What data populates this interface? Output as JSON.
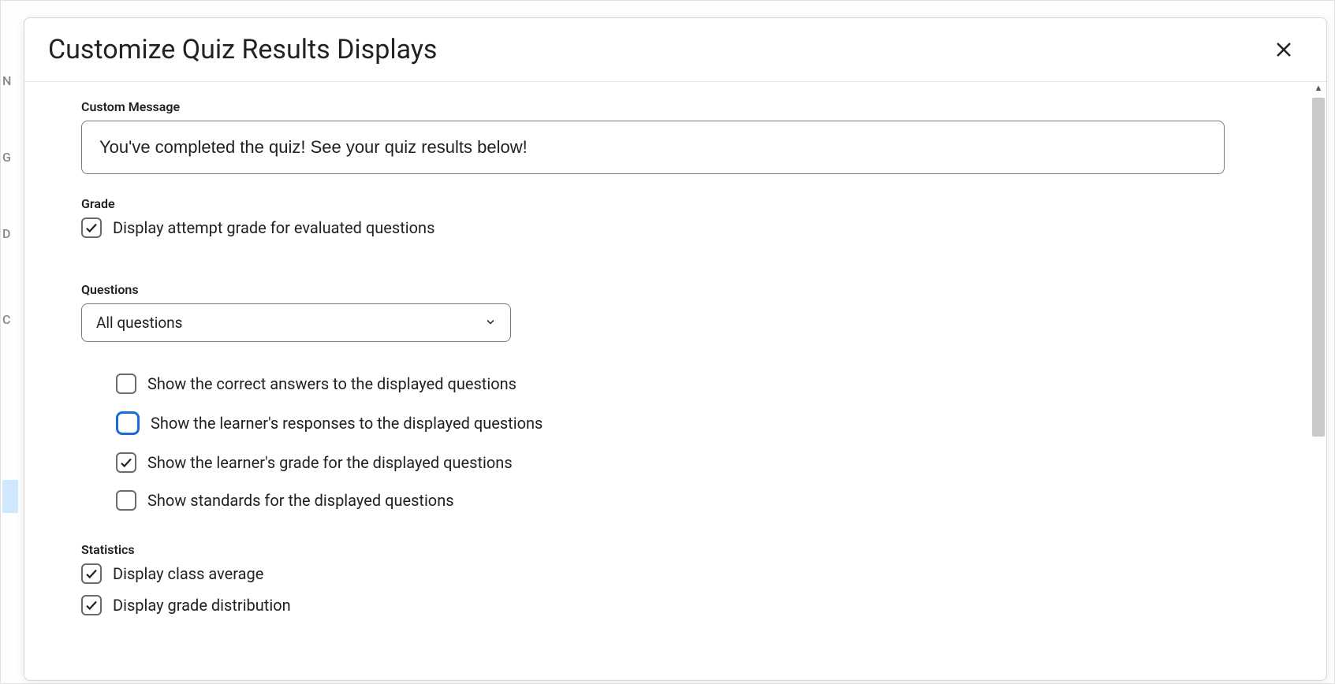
{
  "dialog": {
    "title": "Customize Quiz Results Displays"
  },
  "custom_message": {
    "label": "Custom Message",
    "value": "You've completed the quiz! See your quiz results below!"
  },
  "grade": {
    "label": "Grade",
    "display_attempt": {
      "label": "Display attempt grade for evaluated questions",
      "checked": true
    }
  },
  "questions": {
    "label": "Questions",
    "select_value": "All questions",
    "options": [
      {
        "label": "Show the correct answers to the displayed questions",
        "checked": false,
        "focused": false
      },
      {
        "label": "Show the learner's responses to the displayed questions",
        "checked": false,
        "focused": true
      },
      {
        "label": "Show the learner's grade for the displayed questions",
        "checked": true,
        "focused": false
      },
      {
        "label": "Show standards for the displayed questions",
        "checked": false,
        "focused": false
      }
    ]
  },
  "statistics": {
    "label": "Statistics",
    "class_average": {
      "label": "Display class average",
      "checked": true
    },
    "grade_distribution": {
      "label": "Display grade distribution",
      "checked": true
    }
  },
  "background": {
    "side_letters": [
      "N",
      "G",
      "D",
      "C"
    ]
  }
}
